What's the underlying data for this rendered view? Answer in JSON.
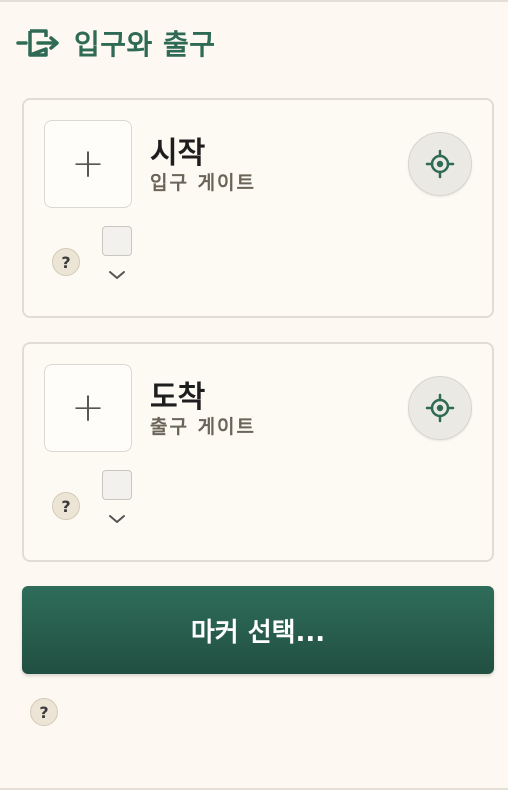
{
  "header": {
    "title": "입구와 출구",
    "icon": "door-exit-icon"
  },
  "cards": [
    {
      "title": "시작",
      "subtitle": "입구 게이트",
      "add_symbol": "+",
      "help_symbol": "?",
      "checkbox_checked": false
    },
    {
      "title": "도착",
      "subtitle": "출구 게이트",
      "add_symbol": "+",
      "help_symbol": "?",
      "checkbox_checked": false
    }
  ],
  "marker_button": {
    "label": "마커 선택..."
  },
  "footer_help": {
    "symbol": "?"
  },
  "colors": {
    "accent": "#2f6a55",
    "button_top": "#2f6d5a",
    "button_bottom": "#214f41",
    "background": "#fdf8f1"
  }
}
